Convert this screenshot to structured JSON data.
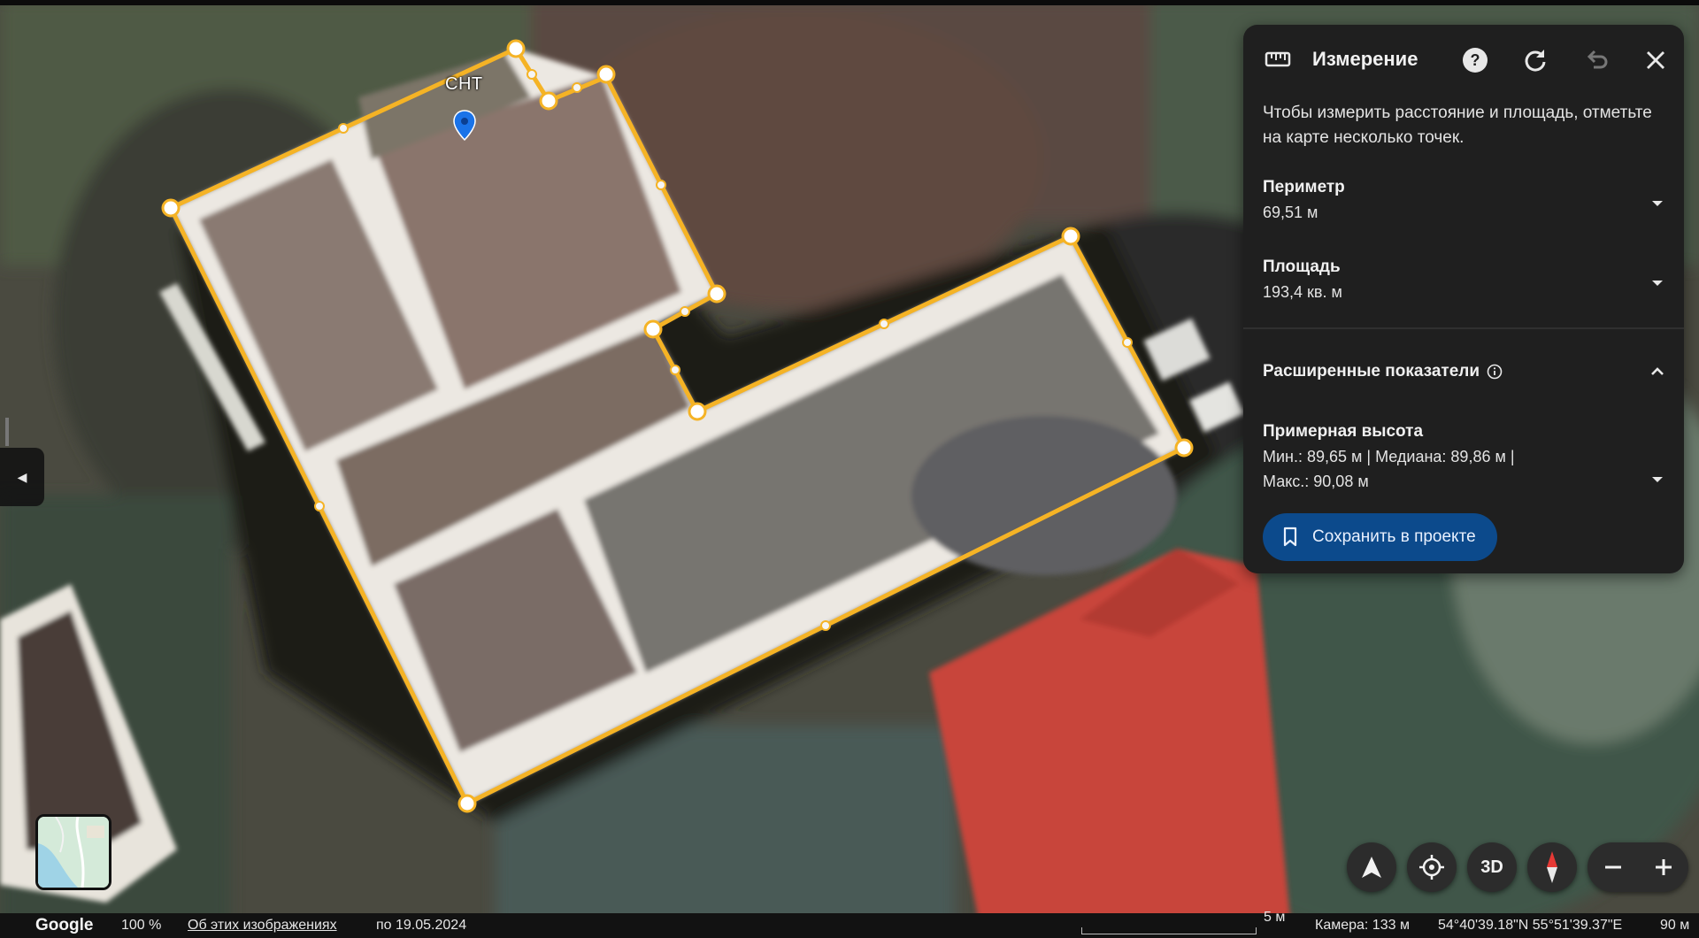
{
  "map": {
    "place_label": "СНТ"
  },
  "panel": {
    "title": "Измерение",
    "description": "Чтобы измерить расстояние и площадь, отметьте на карте несколько точек.",
    "perimeter": {
      "label": "Периметр",
      "value": "69,51 м"
    },
    "area": {
      "label": "Площадь",
      "value": "193,4 кв. м"
    },
    "advanced": {
      "label": "Расширенные показатели"
    },
    "height": {
      "label": "Примерная высота",
      "line1": "Мин.: 89,65 м | Медиана: 89,86 м |",
      "line2": "Макс.: 90,08 м"
    },
    "save_label": "Сохранить в проекте"
  },
  "controls": {
    "three_d_label": "3D"
  },
  "status": {
    "brand": "Google",
    "zoom": "100 %",
    "about_link": "Об этих изображениях",
    "date": "по 19.05.2024",
    "scale": "5 м",
    "camera": "Камера: 133 м",
    "coords": "54°40'39.18\"N 55°51'39.37\"E",
    "altitude": "90 м"
  },
  "colors": {
    "outline": "#f5b325",
    "panel_bg": "#1f1f1f",
    "save_button": "#0c4a8c",
    "roof_red": "#c8453a"
  },
  "icons": [
    "ruler-icon",
    "help-icon",
    "refresh-icon",
    "undo-icon",
    "close-icon",
    "chevron-down-icon",
    "chevron-up-icon",
    "info-icon",
    "bookmark-icon",
    "navigation-arrow-icon",
    "locate-icon",
    "compass-icon",
    "minus-icon",
    "plus-icon",
    "map-pin-icon",
    "chevron-left-icon"
  ]
}
